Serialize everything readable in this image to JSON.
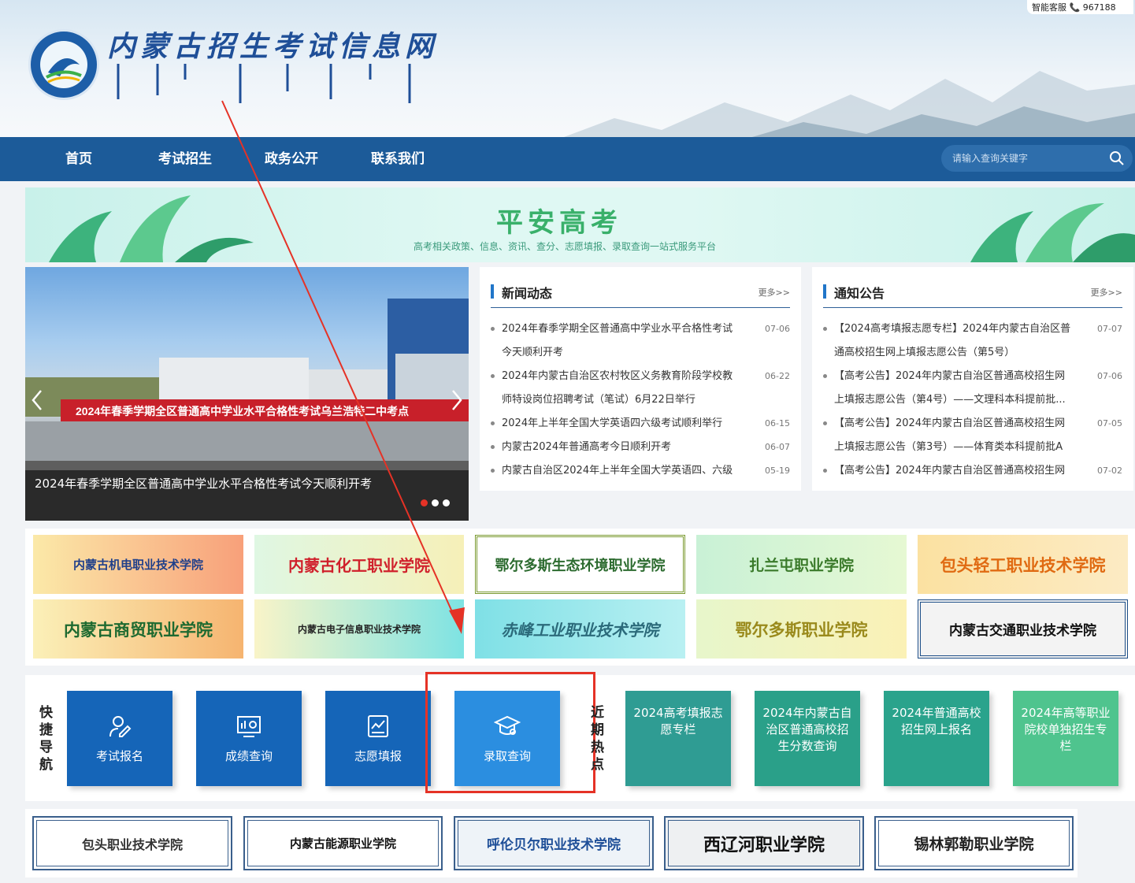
{
  "header": {
    "site_title": "内蒙古招生考试信息网",
    "hotline": "智能客服 📞 967188"
  },
  "nav": {
    "items": [
      "首页",
      "考试招生",
      "政务公开",
      "联系我们"
    ],
    "search_placeholder": "请输入查询关键字"
  },
  "banner": {
    "title": "平安高考",
    "subtitle": "高考相关政策、信息、资讯、查分、志愿填报、录取查询一站式服务平台"
  },
  "slider": {
    "sign_text": "2024年春季学期全区普通高中学业水平合格性考试乌兰浩特二中考点",
    "caption": "2024年春季学期全区普通高中学业水平合格性考试今天顺利开考"
  },
  "news": {
    "title": "新闻动态",
    "more": "更多>>",
    "items": [
      {
        "line1": "2024年春季学期全区普通高中学业水平合格性考试",
        "line2": "今天顺利开考",
        "date": "07-06"
      },
      {
        "line1": "2024年内蒙古自治区农村牧区义务教育阶段学校教",
        "line2": "师特设岗位招聘考试（笔试）6月22日举行",
        "date": "06-22"
      },
      {
        "line1": "2024年上半年全国大学英语四六级考试顺利举行",
        "line2": "",
        "date": "06-15"
      },
      {
        "line1": "内蒙古2024年普通高考今日顺利开考",
        "line2": "",
        "date": "06-07"
      },
      {
        "line1": "内蒙古自治区2024年上半年全国大学英语四、六级",
        "line2": "",
        "date": "05-19"
      }
    ]
  },
  "notices": {
    "title": "通知公告",
    "more": "更多>>",
    "items": [
      {
        "line1": "【2024高考填报志愿专栏】2024年内蒙古自治区普",
        "line2": "通高校招生网上填报志愿公告（第5号）",
        "date": "07-07"
      },
      {
        "line1": "【高考公告】2024年内蒙古自治区普通高校招生网",
        "line2": "上填报志愿公告（第4号）——文理科本科提前批...",
        "date": "07-06"
      },
      {
        "line1": "【高考公告】2024年内蒙古自治区普通高校招生网",
        "line2": "上填报志愿公告（第3号）——体育类本科提前批A",
        "date": "07-05"
      },
      {
        "line1": "【高考公告】2024年内蒙古自治区普通高校招生网",
        "line2": "",
        "date": "07-02"
      }
    ]
  },
  "colleges": [
    {
      "name": "内蒙古机电职业技术学院",
      "color": "#1f3f8a"
    },
    {
      "name": "内蒙古化工职业学院",
      "color": "#d0202b"
    },
    {
      "name": "鄂尔多斯生态环境职业学院",
      "color": "#2c6b2f"
    },
    {
      "name": "扎兰屯职业学院",
      "color": "#3a7a2a"
    },
    {
      "name": "包头轻工职业技术学院",
      "color": "#e06a12"
    },
    {
      "name": "内蒙古商贸职业学院",
      "color": "#1e6a30"
    },
    {
      "name": "内蒙古电子信息职业技术学院",
      "color": "#222222"
    },
    {
      "name": "赤峰工业职业技术学院",
      "color": "#2b6a7a"
    },
    {
      "name": "鄂尔多斯职业学院",
      "color": "#9a8a1c"
    },
    {
      "name": "内蒙古交通职业技术学院",
      "color": "#111111"
    }
  ],
  "quick": {
    "label": "快捷导航",
    "buttons": [
      "考试报名",
      "成绩查询",
      "志愿填报",
      "录取查询"
    ],
    "hot_label": "近期热点",
    "hot": [
      "2024高考填报志愿专栏",
      "2024年内蒙古自治区普通高校招生分数查询",
      "2024年普通高校招生网上报名",
      "2024年高等职业院校单独招生专栏"
    ]
  },
  "bottom_colleges": [
    "包头职业技术学院",
    "内蒙古能源职业学院",
    "呼伦贝尔职业技术学院",
    "西辽河职业学院",
    "锡林郭勒职业学院"
  ],
  "colors": {
    "nav": "#1c5b99",
    "quick_blue": "#1565b8",
    "quick_active": "#2b8ee0",
    "hot_teal": "#2f9c93",
    "highlight": "#e53226"
  }
}
